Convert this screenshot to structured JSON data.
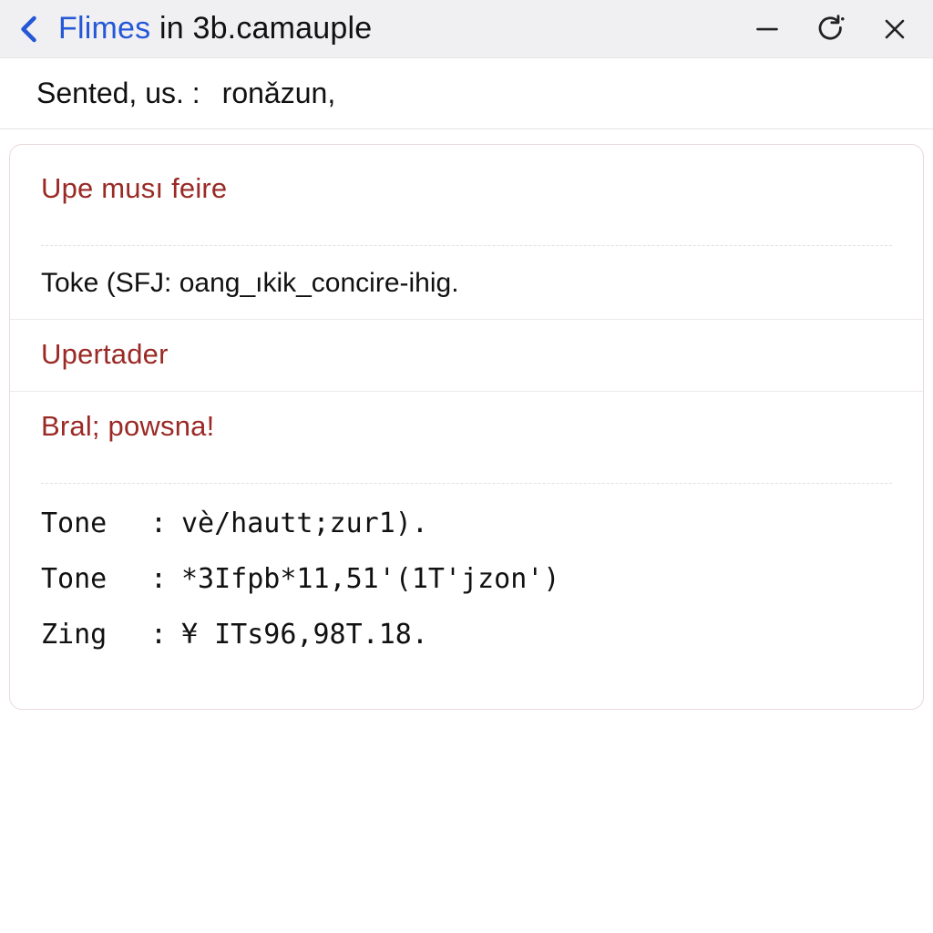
{
  "titlebar": {
    "title_prefix": "Flimes",
    "title_suffix": " in 3b.camauple"
  },
  "subheader": {
    "label": "Sented, us. :",
    "value": "ronǎzun,"
  },
  "card": {
    "section1": {
      "title": "Upe musı feire",
      "body": "Toke (SFJ:  oang_ıkik_concire-ihig."
    },
    "section2": {
      "title": "Upertader"
    },
    "section3": {
      "title": "Bral; powsna!",
      "rows": [
        {
          "key": "Tone",
          "val": "vè/hautt;zur1)."
        },
        {
          "key": "Tone",
          "val": "*3Ifpb*11,51'(1T'jzon')"
        },
        {
          "key": "Zing",
          "val": "¥ ITs96,98T.18."
        }
      ]
    }
  }
}
